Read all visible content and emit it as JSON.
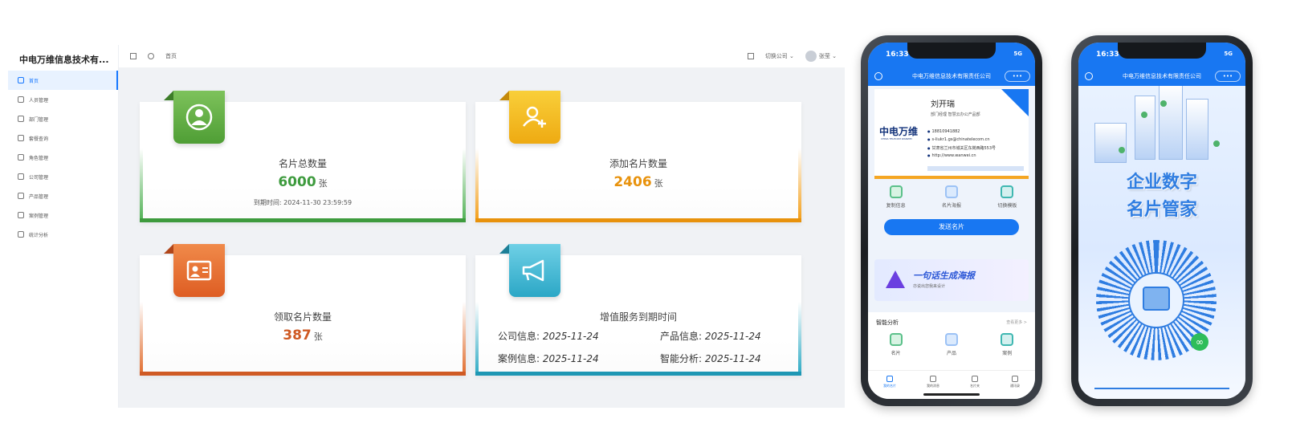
{
  "admin": {
    "brand": "中电万维信息技术有...",
    "menu": [
      "首页",
      "人员管理",
      "部门管理",
      "套餐查询",
      "角色管理",
      "公司管理",
      "产品管理",
      "案例管理",
      "统计分析"
    ],
    "breadcrumb": "首页",
    "switch_company": "切换公司",
    "user": "张莹",
    "colors": {
      "accent": "#1677ff"
    }
  },
  "cards": {
    "total": {
      "title": "名片总数量",
      "value": "6000",
      "unit": "张",
      "expire_label": "到期时间:",
      "expire_value": "2024-11-30 23:59:59",
      "color": "#3e9b3e"
    },
    "added": {
      "title": "添加名片数量",
      "value": "2406",
      "unit": "张",
      "color": "#e8920c"
    },
    "claimed": {
      "title": "领取名片数量",
      "value": "387",
      "unit": "张",
      "color": "#cf5a24"
    },
    "service": {
      "title": "增值服务到期时间",
      "company_label": "公司信息:",
      "company_date": "2025-11-24",
      "product_label": "产品信息:",
      "product_date": "2025-11-24",
      "case_label": "案例信息:",
      "case_date": "2025-11-24",
      "ai_label": "智能分析:",
      "ai_date": "2025-11-24",
      "color": "#1e97b4"
    }
  },
  "phone1": {
    "time": "16:33",
    "signal": "5G",
    "nav_title": "中电万维信息技术有限责任公司",
    "nav_more": "•••",
    "person_name": "刘开瑞",
    "person_role": "部门经理 智慧云办公产品部",
    "logo": "中电万维",
    "logo_sub": "CHINA TELECOM WANWEI",
    "phone": "18810941882",
    "email": "s-liukr1.gs@chinatelecom.cn",
    "address": "甘肃省兰州市城关区东岗西路553号",
    "website": "http://www.wanwei.cn",
    "actions": [
      "复制信息",
      "名片海报",
      "切换模板"
    ],
    "send_button": "发送名片",
    "banner_title": "一句话生成海报",
    "banner_sub": "亦说出您我来设计",
    "smart_title": "智能分析",
    "smart_more": "查看更多 >",
    "smart_items": [
      "名片",
      "产品",
      "案例"
    ],
    "tabs": [
      "我的名片",
      "我的消息",
      "名片夹",
      "通讯录"
    ]
  },
  "phone2": {
    "time": "16:33",
    "signal": "5G",
    "nav_title": "中电万维信息技术有限责任公司",
    "nav_more": "•••",
    "slogan_line1": "企业数字",
    "slogan_line2": "名片管家"
  }
}
